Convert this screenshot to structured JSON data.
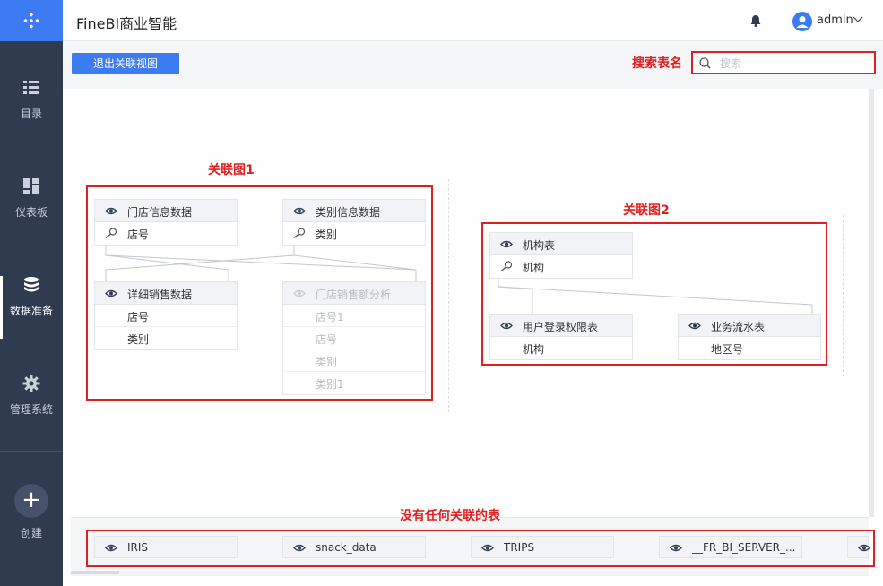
{
  "sidebar": {
    "items": [
      {
        "label": "目录",
        "icon": "list-icon"
      },
      {
        "label": "仪表板",
        "icon": "dashboard-icon"
      },
      {
        "label": "数据准备",
        "icon": "database-icon"
      },
      {
        "label": "管理系统",
        "icon": "gear-icon"
      }
    ],
    "create_label": "创建",
    "active_item": "数据准备"
  },
  "header": {
    "title": "FineBI商业智能",
    "user": "admin"
  },
  "toolbar": {
    "exit_label": "退出关联视图",
    "search_placeholder": "搜索"
  },
  "annotations": {
    "search": "搜索表名",
    "graph1": "关联图1",
    "graph2": "关联图2",
    "unlinked": "没有任何关联的表"
  },
  "graph1": {
    "store_info": {
      "name": "门店信息数据",
      "fields": [
        "店号"
      ]
    },
    "category_info": {
      "name": "类别信息数据",
      "fields": [
        "类别"
      ]
    },
    "sales_detail": {
      "name": "详细销售数据",
      "fields": [
        "店号",
        "类别"
      ]
    },
    "store_sales": {
      "name": "门店销售额分析",
      "fields": [
        "店号1",
        "店号",
        "类别",
        "类别1"
      ]
    }
  },
  "graph2": {
    "org": {
      "name": "机构表",
      "fields": [
        "机构"
      ]
    },
    "login": {
      "name": "用户登录权限表",
      "fields": [
        "机构"
      ]
    },
    "flow": {
      "name": "业务流水表",
      "fields": [
        "地区号"
      ]
    }
  },
  "unlinked_tables": [
    "IRIS",
    "snack_data",
    "TRIPS",
    "__FR_BI_SERVER_..."
  ],
  "colors": {
    "accent": "#3d7bf2",
    "sidebar": "#2f3b4f",
    "annotation": "#e02020"
  }
}
